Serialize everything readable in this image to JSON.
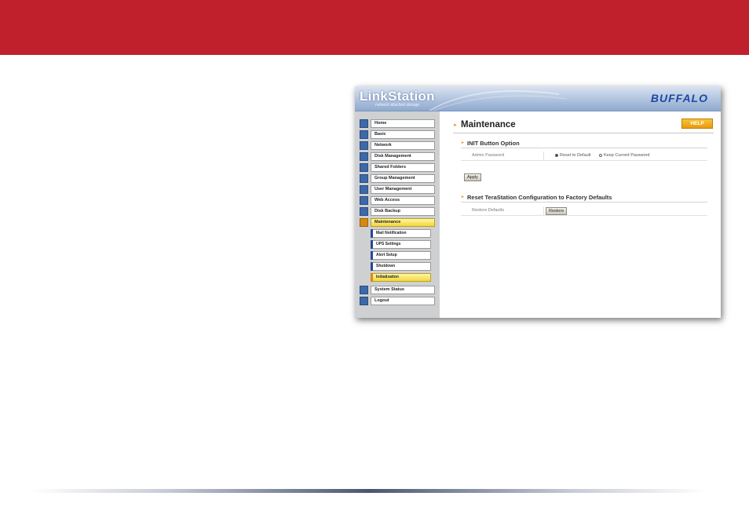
{
  "app": {
    "product": "LinkStation",
    "product_subtitle": "network attached storage",
    "brand": "BUFFALO"
  },
  "sidebar": {
    "items": [
      {
        "label": "Home",
        "icon": "home-icon"
      },
      {
        "label": "Basic",
        "icon": "basic-icon"
      },
      {
        "label": "Network",
        "icon": "network-icon"
      },
      {
        "label": "Disk Management",
        "icon": "disk-management-icon"
      },
      {
        "label": "Shared Folders",
        "icon": "shared-folders-icon"
      },
      {
        "label": "Group Management",
        "icon": "group-management-icon"
      },
      {
        "label": "User Management",
        "icon": "user-management-icon"
      },
      {
        "label": "Web Access",
        "icon": "web-access-icon"
      },
      {
        "label": "Disk Backup",
        "icon": "disk-backup-icon"
      },
      {
        "label": "Maintenance",
        "icon": "maintenance-icon",
        "active": true
      }
    ],
    "subitems": [
      {
        "label": "Mail Notification"
      },
      {
        "label": "UPS Settings"
      },
      {
        "label": "Alert Setup"
      },
      {
        "label": "Shutdown"
      },
      {
        "label": "Initialization",
        "active": true
      }
    ],
    "bottom_items": [
      {
        "label": "System Status",
        "icon": "system-status-icon"
      },
      {
        "label": "Logout",
        "icon": "logout-icon"
      }
    ]
  },
  "main": {
    "title": "Maintenance",
    "help_label": "HELP",
    "sections": [
      {
        "heading": "INIT Button Option",
        "row_label": "Admin Password",
        "options": [
          {
            "label": "Reset to Default",
            "selected": true
          },
          {
            "label": "Keep Current Password",
            "selected": false
          }
        ],
        "button": "Apply"
      },
      {
        "heading": "Reset TeraStation Configuration to Factory Defaults",
        "row_label": "Restore Defaults",
        "button": "Restore"
      }
    ]
  },
  "colors": {
    "banner_red": "#c0202c",
    "active_yellow": "#f3d738",
    "nav_blue": "#3e69a8",
    "help_orange": "#e89a0b"
  }
}
